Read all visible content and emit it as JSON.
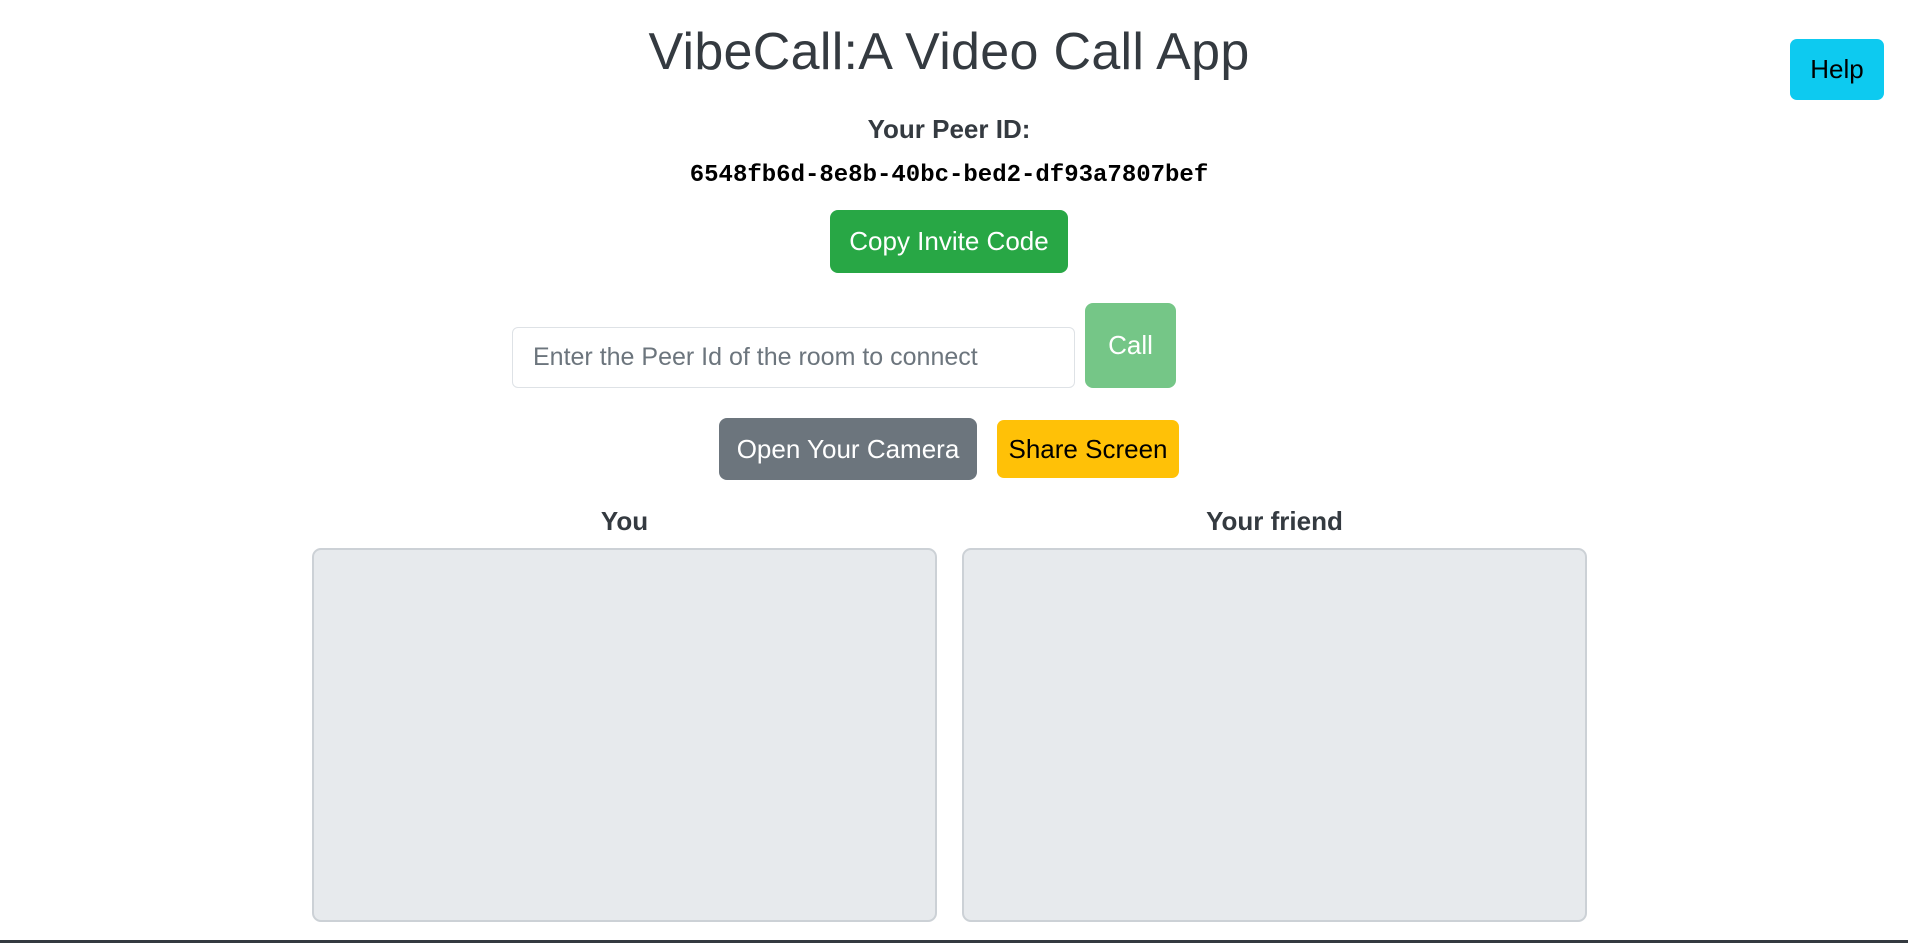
{
  "header": {
    "title": "VibeCall:A Video Call App",
    "help_label": "Help"
  },
  "peer": {
    "label": "Your Peer ID:",
    "id": "6548fb6d-8e8b-40bc-bed2-df93a7807bef",
    "copy_label": "Copy Invite Code"
  },
  "connect": {
    "placeholder": "Enter the Peer Id of the room to connect",
    "value": "",
    "call_label": "Call"
  },
  "controls": {
    "camera_label": "Open Your Camera",
    "share_label": "Share Screen"
  },
  "videos": {
    "local_label": "You",
    "remote_label": "Your friend"
  },
  "colors": {
    "primary_success": "#28a745",
    "call_disabled": "#75c687",
    "secondary": "#6c757d",
    "warning": "#ffc107",
    "info": "#0dcaf0",
    "video_background": "#e7eaed"
  }
}
